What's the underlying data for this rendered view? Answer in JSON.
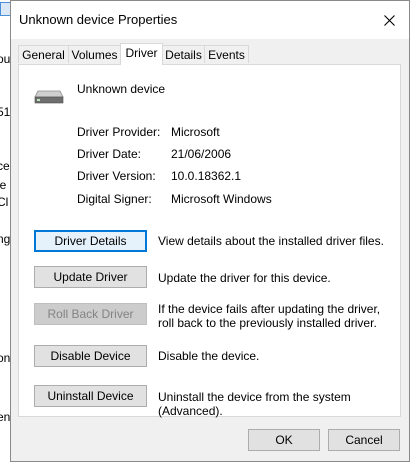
{
  "background_window": {
    "fragments": [
      "ou",
      "51",
      "ce",
      "le",
      "Cl",
      "ng",
      "on",
      "en"
    ]
  },
  "dialog": {
    "title": "Unknown device Properties",
    "close_icon": "close-icon"
  },
  "tabs": [
    {
      "label": "General",
      "active": false
    },
    {
      "label": "Volumes",
      "active": false
    },
    {
      "label": "Driver",
      "active": true
    },
    {
      "label": "Details",
      "active": false
    },
    {
      "label": "Events",
      "active": false
    }
  ],
  "device": {
    "name": "Unknown device",
    "icon": "drive-icon"
  },
  "info": {
    "provider_label": "Driver Provider:",
    "provider_value": "Microsoft",
    "date_label": "Driver Date:",
    "date_value": "21/06/2006",
    "version_label": "Driver Version:",
    "version_value": "10.0.18362.1",
    "signer_label": "Digital Signer:",
    "signer_value": "Microsoft Windows"
  },
  "actions": [
    {
      "label": "Driver Details",
      "description": "View details about the installed driver files.",
      "state": "focused"
    },
    {
      "label": "Update Driver",
      "description": "Update the driver for this device.",
      "state": "normal"
    },
    {
      "label": "Roll Back Driver",
      "description": "If the device fails after updating the driver, roll back to the previously installed driver.",
      "state": "disabled"
    },
    {
      "label": "Disable Device",
      "description": "Disable the device.",
      "state": "normal"
    },
    {
      "label": "Uninstall Device",
      "description": "Uninstall the device from the system (Advanced).",
      "state": "normal"
    }
  ],
  "footer": {
    "ok_label": "OK",
    "cancel_label": "Cancel"
  },
  "colors": {
    "focus_accent": "#0078d7",
    "dialog_background": "#f0f0f0",
    "disabled_text": "#838383"
  }
}
